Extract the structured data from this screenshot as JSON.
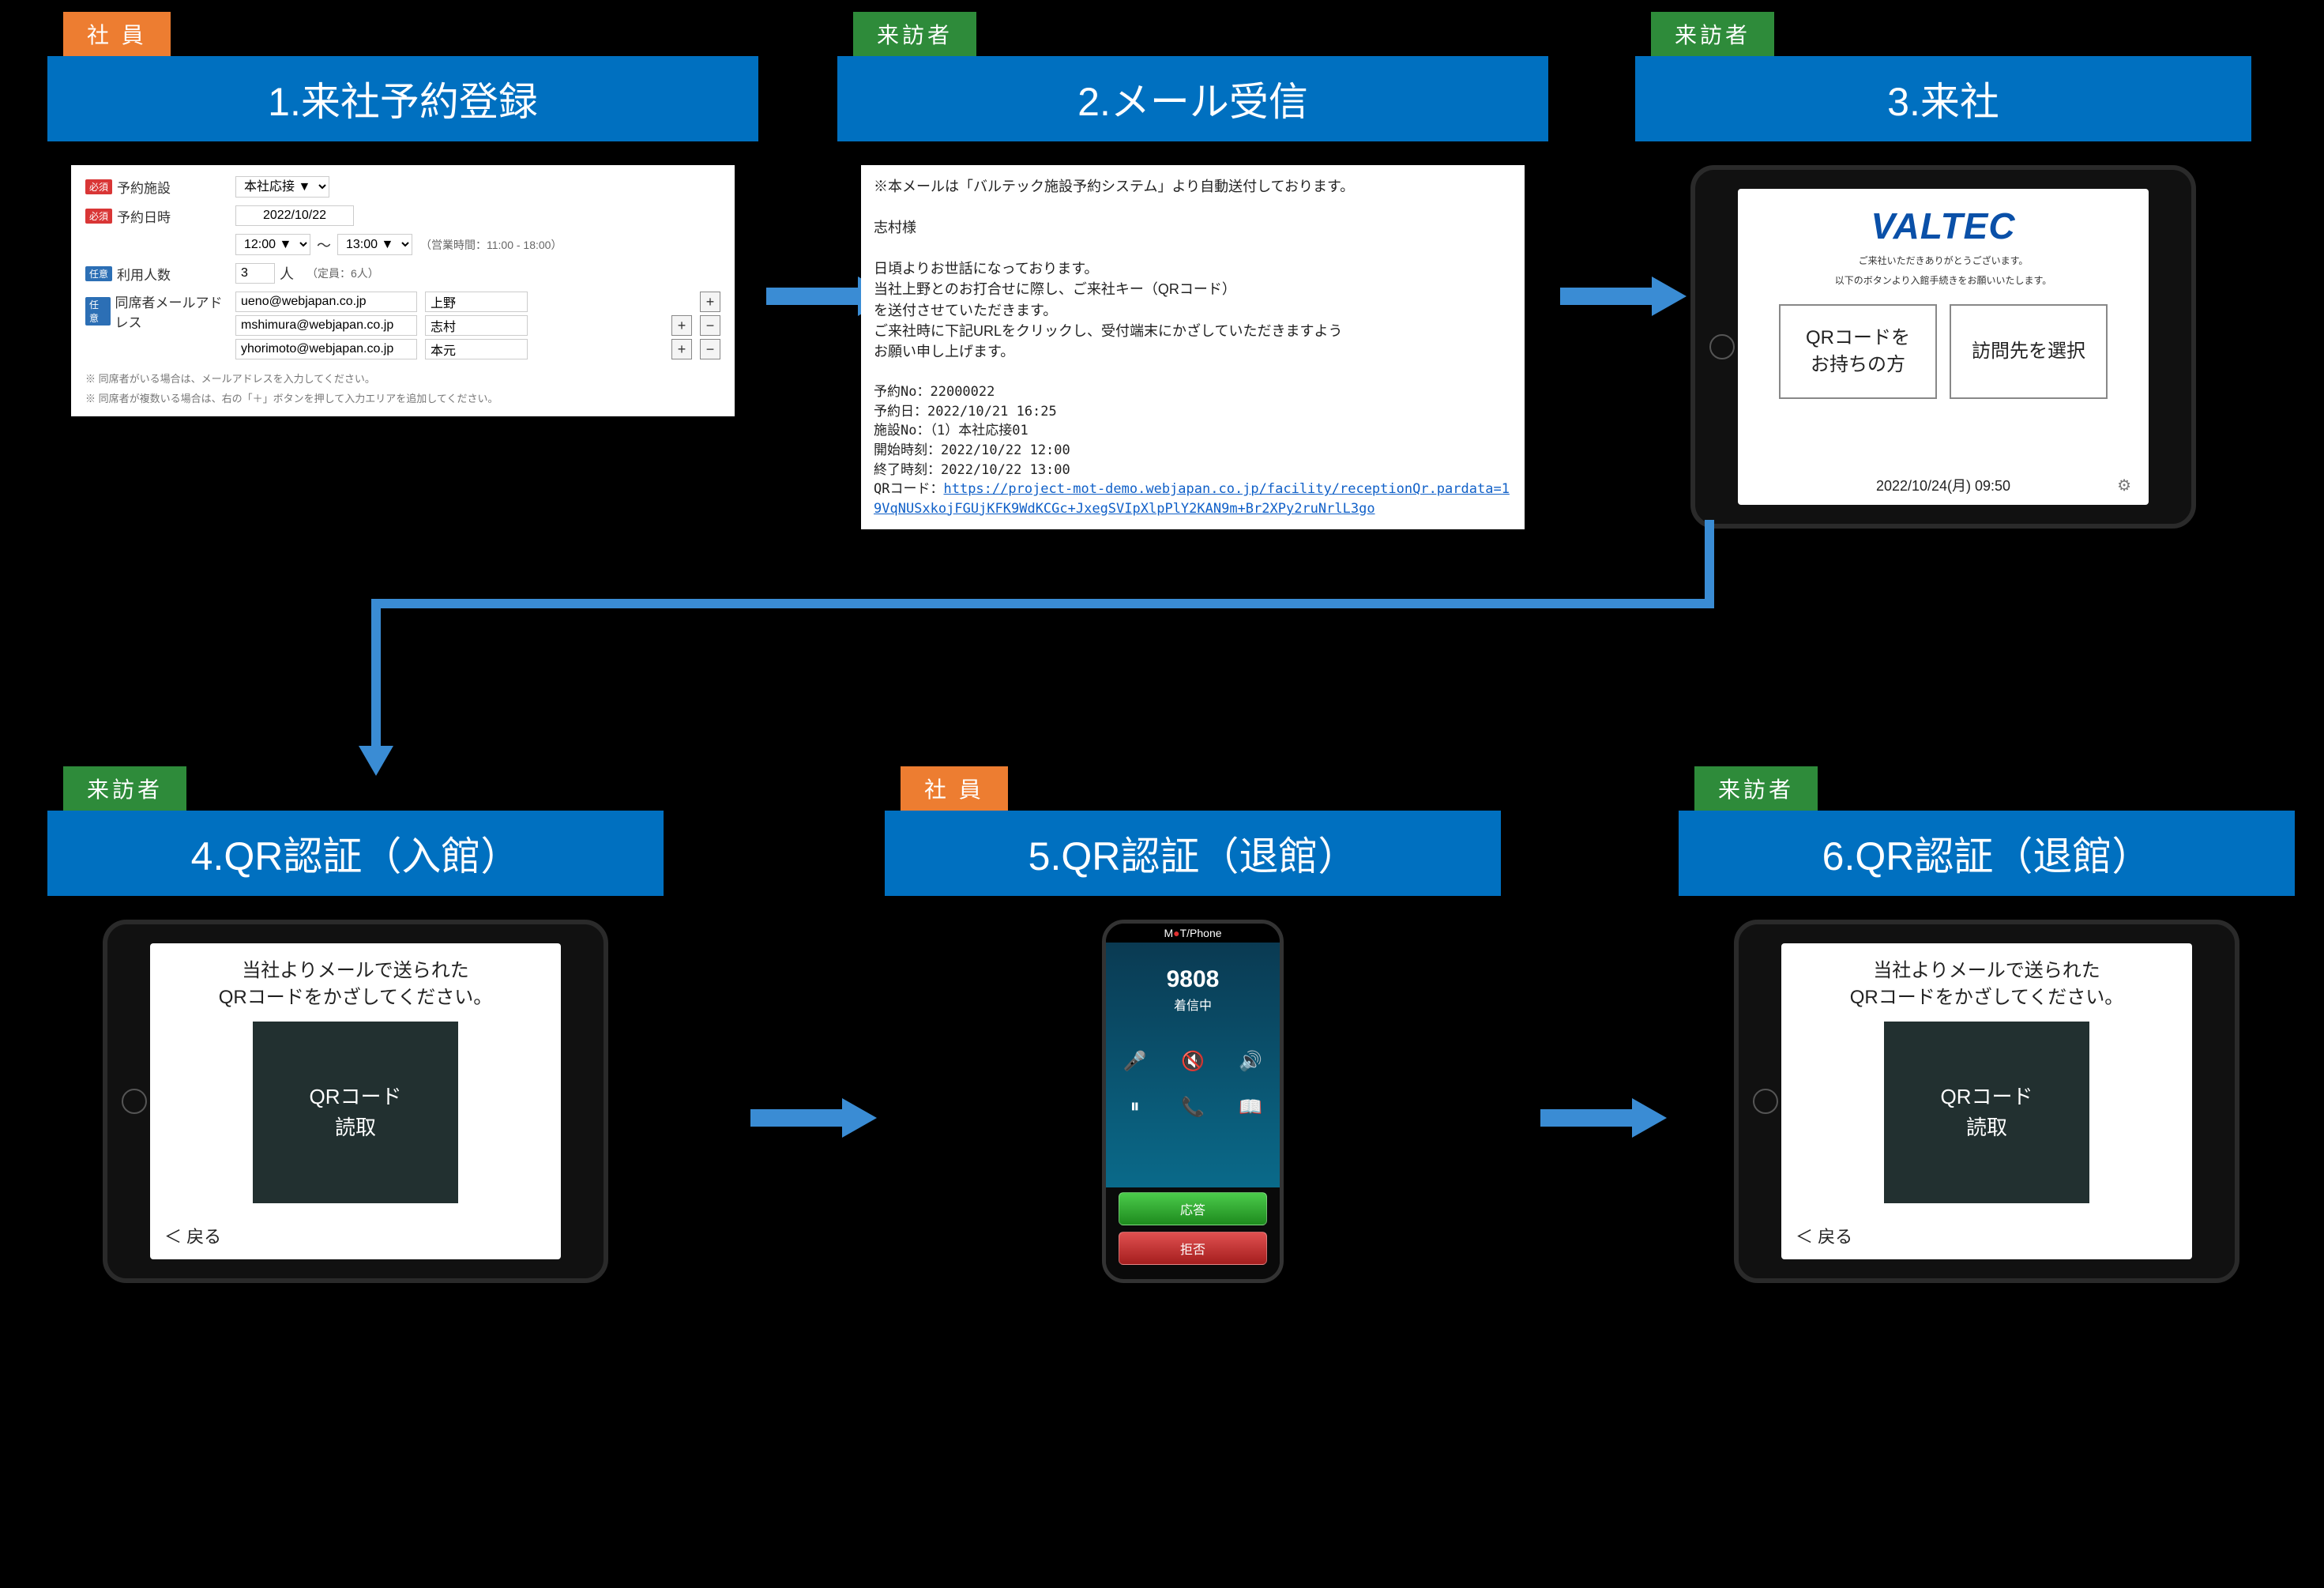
{
  "roles": {
    "employee": "社 員",
    "visitor": "来訪者"
  },
  "steps": {
    "s1": {
      "title": "1.来社予約登録"
    },
    "s2": {
      "title": "2.メール受信"
    },
    "s3": {
      "title": "3.来社"
    },
    "s4": {
      "title": "4.QR認証（入館）"
    },
    "s5": {
      "title": "5.QR認証（退館）"
    },
    "s6": {
      "title": "6.QR認証（退館）"
    }
  },
  "form": {
    "labels": {
      "location": "予約施設",
      "date": "予約日時",
      "people": "利用人数",
      "emails": "同席者メールアドレス",
      "req": "必須",
      "opt": "任意"
    },
    "location_value": "本社応接 ▼",
    "date_value": "2022/10/22",
    "time_from": "12:00 ▼",
    "time_sep": "～",
    "time_to": "13:00 ▼",
    "hours_note": "（営業時間：11:00 - 18:00）",
    "people_value": "3",
    "people_unit": "人",
    "capacity": "（定員：6人）",
    "emails": [
      {
        "addr": "ueno@webjapan.co.jp",
        "name": "上野"
      },
      {
        "addr": "mshimura@webjapan.co.jp",
        "name": "志村"
      },
      {
        "addr": "yhorimoto@webjapan.co.jp",
        "name": "本元"
      }
    ],
    "foot1": "※ 同席者がいる場合は、メールアドレスを入力してください。",
    "foot2": "※ 同席者が複数いる場合は、右の「＋」ボタンを押して入力エリアを追加してください。"
  },
  "email": {
    "header": "※本メールは「バルテック施設予約システム」より自動送付しております。",
    "greeting": "志村様",
    "body1": "日頃よりお世話になっております。",
    "body2": "当社上野とのお打合せに際し、ご来社キー（QRコード）",
    "body3": "を送付させていただきます。",
    "body4": "ご来社時に下記URLをクリックし、受付端末にかざしていただきますよう",
    "body5": "お願い申し上げます。",
    "fields": {
      "no_l": "予約No：",
      "no_v": "22000022",
      "date_l": "予約日：",
      "date_v": "2022/10/21 16:25",
      "fac_l": "施設No：",
      "fac_v": "（1）本社応接01",
      "start_l": "開始時刻：",
      "start_v": "2022/10/22 12:00",
      "end_l": "終了時刻：",
      "end_v": "2022/10/22 13:00",
      "qr_l": "QRコード："
    },
    "url": "https://project-mot-demo.webjapan.co.jp/facility/receptionQr.pardata=19VqNUSxkojFGUjKFK9WdKCGc+JxegSVIpXlpPlY2KAN9m+Br2XPy2ruNrlL3go"
  },
  "reception": {
    "logo": "VALTEC",
    "sub1": "ご来社いただきありがとうございます。",
    "sub2": "以下のボタンより入館手続きをお願いいたします。",
    "btn_qr": "QRコードを\nお持ちの方",
    "btn_dest": "訪問先を選択",
    "datetime": "2022/10/24(月) 09:50"
  },
  "qr": {
    "line1": "当社よりメールで送られた",
    "line2": "QRコードをかざしてください。",
    "box": "QRコード\n読取",
    "back": "＜ 戻る"
  },
  "phone": {
    "app": "M●T/Phone",
    "number": "9808",
    "status": "着信中",
    "answer": "応答",
    "reject": "拒否"
  }
}
